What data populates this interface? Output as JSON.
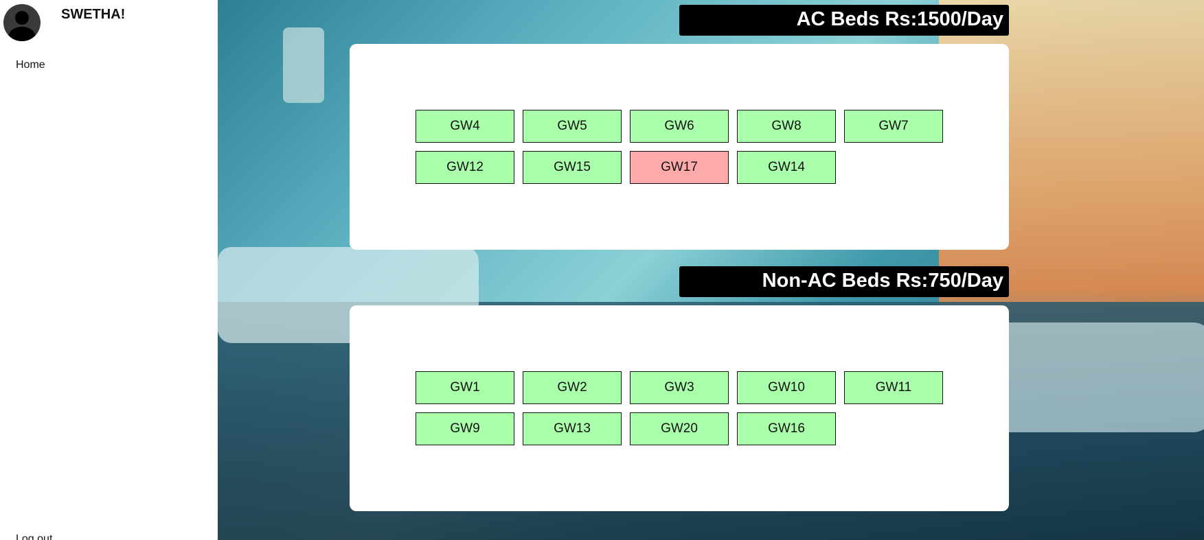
{
  "sidebar": {
    "username": "SWETHA!",
    "nav": {
      "home_label": "Home",
      "logout_label": "Log out"
    }
  },
  "colors": {
    "available": "#aaffaa",
    "occupied": "#ffaaaa",
    "title_bg": "#000000"
  },
  "ac_section": {
    "title": "AC Beds Rs:1500/Day",
    "beds": [
      {
        "label": "GW4",
        "status": "available"
      },
      {
        "label": "GW5",
        "status": "available"
      },
      {
        "label": "GW6",
        "status": "available"
      },
      {
        "label": "GW8",
        "status": "available"
      },
      {
        "label": "GW7",
        "status": "available"
      },
      {
        "label": "GW12",
        "status": "available"
      },
      {
        "label": "GW15",
        "status": "available"
      },
      {
        "label": "GW17",
        "status": "occupied"
      },
      {
        "label": "GW14",
        "status": "available"
      }
    ]
  },
  "nonac_section": {
    "title": "Non-AC Beds Rs:750/Day",
    "beds": [
      {
        "label": "GW1",
        "status": "available"
      },
      {
        "label": "GW2",
        "status": "available"
      },
      {
        "label": "GW3",
        "status": "available"
      },
      {
        "label": "GW10",
        "status": "available"
      },
      {
        "label": "GW11",
        "status": "available"
      },
      {
        "label": "GW9",
        "status": "available"
      },
      {
        "label": "GW13",
        "status": "available"
      },
      {
        "label": "GW20",
        "status": "available"
      },
      {
        "label": "GW16",
        "status": "available"
      }
    ]
  }
}
